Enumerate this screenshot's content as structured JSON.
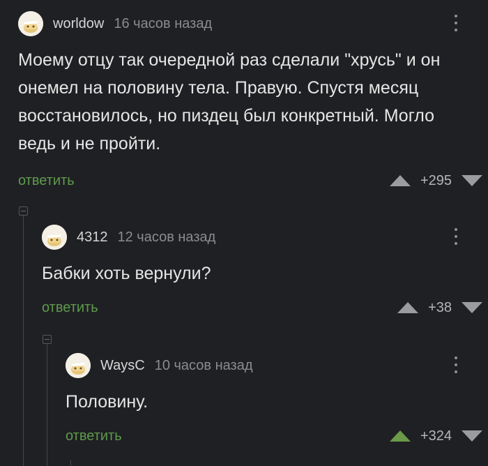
{
  "comments": [
    {
      "username": "worldow",
      "time": "16 часов назад",
      "text": "Моему отцу так очередной раз сделали \"хрусь\" и он онемел на половину тела. Правую. Спустя месяц восстановилось, но пиздец был конкретный. Могло ведь и не пройти.",
      "reply_label": "ответить",
      "score": "+295",
      "upvoted": false
    },
    {
      "username": "4312",
      "time": "12 часов назад",
      "text": "Бабки хоть вернули?",
      "reply_label": "ответить",
      "score": "+38",
      "upvoted": false
    },
    {
      "username": "WaysC",
      "time": "10 часов назад",
      "text": "Половину.",
      "reply_label": "ответить",
      "score": "+324",
      "upvoted": true
    }
  ],
  "colors": {
    "background": "#1f2023",
    "reply_link": "#5f9a4e",
    "upvote_active": "#6b9a4a",
    "vote_inactive": "#9a9c9f"
  },
  "icons": [
    "avatar-icon",
    "more-vert-icon",
    "upvote-icon",
    "downvote-icon",
    "collapse-thread-icon"
  ]
}
